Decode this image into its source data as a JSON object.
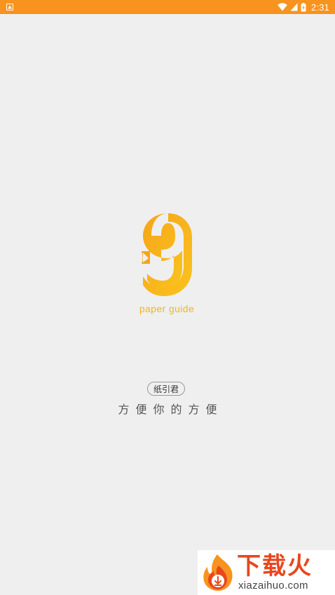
{
  "status_bar": {
    "time": "2:31",
    "icons": [
      "app-notification-icon",
      "wifi-icon",
      "cell-signal-icon",
      "battery-charging-icon"
    ],
    "background_color": "#f7931e"
  },
  "logo": {
    "glyph": "9",
    "caption": "paper guide",
    "color": "#f7b51a"
  },
  "brand": {
    "name": "纸引君",
    "slogan": "方便你的方便"
  },
  "watermark": {
    "title": "下载火",
    "domain": "xiazaihuo.com",
    "color": "#e8471e"
  }
}
